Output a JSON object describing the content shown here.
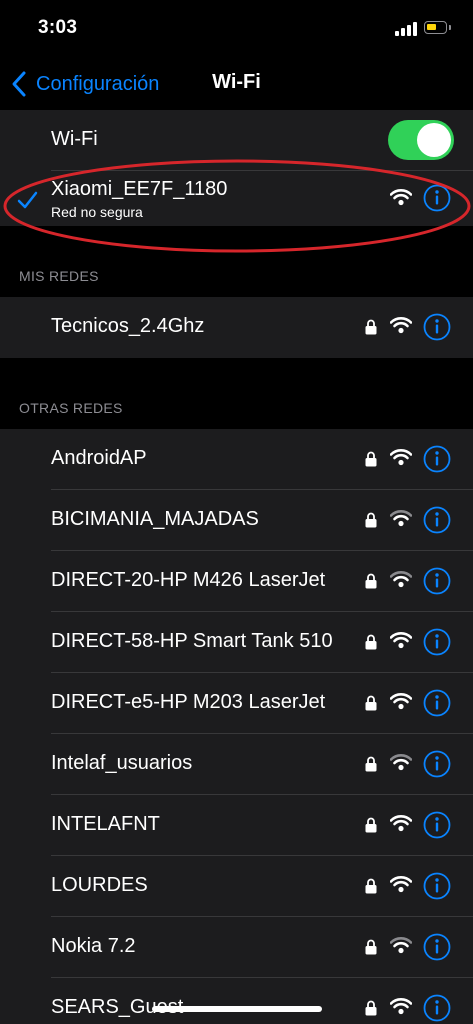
{
  "status": {
    "time": "3:03"
  },
  "nav": {
    "back_label": "Configuración",
    "title": "Wi-Fi"
  },
  "wifi_toggle": {
    "label": "Wi-Fi",
    "on": true
  },
  "connected": {
    "name": "Xiaomi_EE7F_1180",
    "subtitle": "Red no segura"
  },
  "sections": {
    "my_networks": "MIS REDES",
    "other_networks": "OTRAS REDES"
  },
  "my_networks": [
    {
      "name": "Tecnicos_2.4Ghz",
      "secured": true,
      "signal": 3
    }
  ],
  "other_networks": [
    {
      "name": "AndroidAP",
      "secured": true,
      "signal": 3
    },
    {
      "name": "BICIMANIA_MAJADAS",
      "secured": true,
      "signal": 2
    },
    {
      "name": "DIRECT-20-HP M426 LaserJet",
      "secured": true,
      "signal": 2
    },
    {
      "name": "DIRECT-58-HP Smart Tank 510",
      "secured": true,
      "signal": 3
    },
    {
      "name": "DIRECT-e5-HP M203 LaserJet",
      "secured": true,
      "signal": 3
    },
    {
      "name": "Intelaf_usuarios",
      "secured": true,
      "signal": 2
    },
    {
      "name": "INTELAFNT",
      "secured": true,
      "signal": 3
    },
    {
      "name": "LOURDES",
      "secured": true,
      "signal": 3
    },
    {
      "name": "Nokia 7.2",
      "secured": true,
      "signal": 2
    },
    {
      "name": "SEARS_Guest",
      "secured": true,
      "signal": 3
    }
  ],
  "colors": {
    "accent": "#0a84ff",
    "toggle_on": "#30d158",
    "annotation": "#d6262b"
  },
  "icons": {
    "check": "checkmark-icon",
    "lock": "lock-icon",
    "wifi": "wifi-icon",
    "info": "info-icon",
    "back": "chevron-left-icon"
  }
}
